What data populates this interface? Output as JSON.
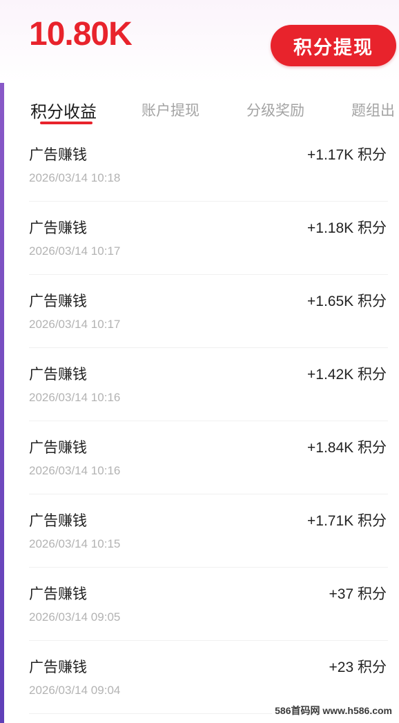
{
  "header": {
    "balance": "10.80K",
    "withdraw_label": "积分提现"
  },
  "tabs": [
    {
      "label": "积分收益",
      "active": true
    },
    {
      "label": "账户提现",
      "active": false
    },
    {
      "label": "分级奖励",
      "active": false
    },
    {
      "label": "题组出",
      "active": false
    }
  ],
  "records": [
    {
      "title": "广告赚钱",
      "time": "2026/03/14 10:18",
      "amount": "+1.17K 积分"
    },
    {
      "title": "广告赚钱",
      "time": "2026/03/14 10:17",
      "amount": "+1.18K 积分"
    },
    {
      "title": "广告赚钱",
      "time": "2026/03/14 10:17",
      "amount": "+1.65K 积分"
    },
    {
      "title": "广告赚钱",
      "time": "2026/03/14 10:16",
      "amount": "+1.42K 积分"
    },
    {
      "title": "广告赚钱",
      "time": "2026/03/14 10:16",
      "amount": "+1.84K 积分"
    },
    {
      "title": "广告赚钱",
      "time": "2026/03/14 10:15",
      "amount": "+1.71K 积分"
    },
    {
      "title": "广告赚钱",
      "time": "2026/03/14 09:05",
      "amount": "+37 积分"
    },
    {
      "title": "广告赚钱",
      "time": "2026/03/14 09:04",
      "amount": "+23 积分"
    }
  ],
  "watermark": "586首码网 www.h586.com",
  "colors": {
    "accent": "#e8232c",
    "text_primary": "#222222",
    "text_secondary": "#b3b3b3",
    "tab_inactive": "#a3a3a3"
  }
}
